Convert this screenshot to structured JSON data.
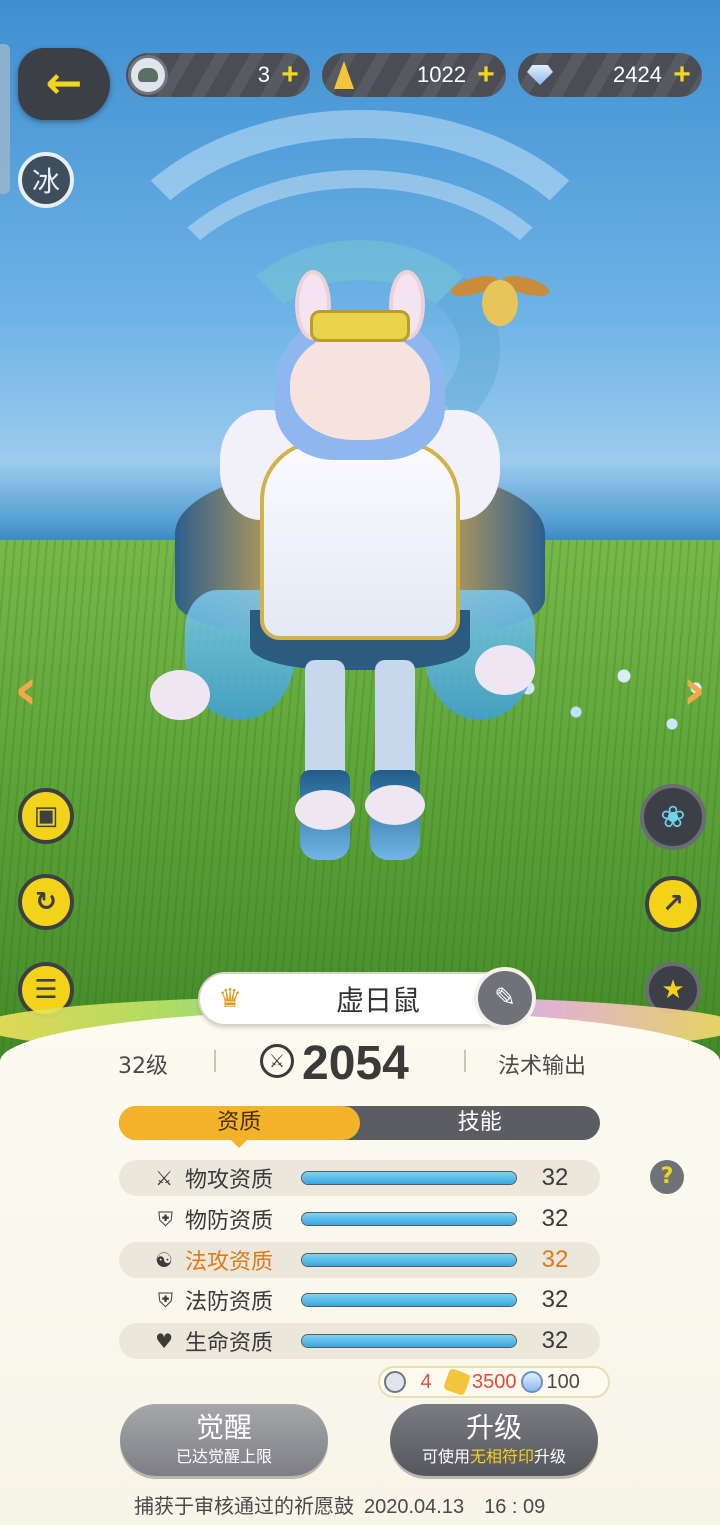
{
  "resources": [
    {
      "icon": "avatar-token-icon",
      "value": "3",
      "plus": "+"
    },
    {
      "icon": "crystal-icon",
      "value": "1022",
      "plus": "+"
    },
    {
      "icon": "diamond-icon",
      "value": "2424",
      "plus": "+"
    }
  ],
  "element_badge": "冰",
  "pet": {
    "name": "虚日鼠",
    "level": "32级",
    "power": "2054",
    "role": "法术输出"
  },
  "tabs": [
    {
      "label": "资质",
      "active": true
    },
    {
      "label": "技能",
      "active": false
    }
  ],
  "stats": [
    {
      "icon": "swords-icon",
      "label": "物攻资质",
      "value": "32",
      "fill": 1.0,
      "highlight": false
    },
    {
      "icon": "shield-icon",
      "label": "物防资质",
      "value": "32",
      "fill": 1.0,
      "highlight": false
    },
    {
      "icon": "swirl-icon",
      "label": "法攻资质",
      "value": "32",
      "fill": 1.0,
      "highlight": true
    },
    {
      "icon": "shield-icon",
      "label": "法防资质",
      "value": "32",
      "fill": 1.0,
      "highlight": false
    },
    {
      "icon": "heart-icon",
      "label": "生命资质",
      "value": "32",
      "fill": 1.0,
      "highlight": false
    }
  ],
  "cost": {
    "token": "4",
    "crystal": "3500",
    "diamond": "100"
  },
  "buttons": {
    "awaken": {
      "title": "觉醒",
      "subtitle": "已达觉醒上限"
    },
    "upgrade": {
      "title": "升级",
      "sub_prefix": "可使用",
      "sub_highlight": "无相符印",
      "sub_suffix": "升级"
    }
  },
  "footer": {
    "capture_text": "捕获于审核通过的祈愿鼓",
    "capture_date": "2020.04.13　16 : 09"
  },
  "colors": {
    "accent_yellow": "#f2d31a",
    "tab_active": "#f2b32a",
    "highlight_orange": "#e07a18",
    "cost_red": "#e24a3a"
  }
}
